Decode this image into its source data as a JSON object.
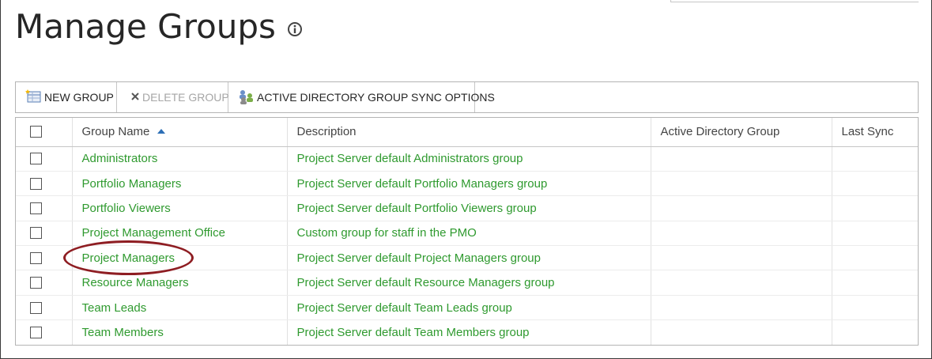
{
  "page": {
    "title": "Manage Groups"
  },
  "toolbar": {
    "new_group": "NEW GROUP",
    "delete_group": "DELETE GROUP",
    "ad_sync": "ACTIVE DIRECTORY GROUP SYNC OPTIONS"
  },
  "table": {
    "columns": [
      "Group Name",
      "Description",
      "Active Directory Group",
      "Last Sync"
    ],
    "sorted_column": "Group Name",
    "sort_direction": "ascending",
    "rows": [
      {
        "name": "Administrators",
        "description": "Project Server default Administrators group",
        "ad_group": "",
        "last_sync": ""
      },
      {
        "name": "Portfolio Managers",
        "description": "Project Server default Portfolio Managers group",
        "ad_group": "",
        "last_sync": ""
      },
      {
        "name": "Portfolio Viewers",
        "description": "Project Server default Portfolio Viewers group",
        "ad_group": "",
        "last_sync": ""
      },
      {
        "name": "Project Management Office",
        "description": "Custom group for staff in the PMO",
        "ad_group": "",
        "last_sync": ""
      },
      {
        "name": "Project Managers",
        "description": "Project Server default Project Managers group",
        "ad_group": "",
        "last_sync": ""
      },
      {
        "name": "Resource Managers",
        "description": "Project Server default Resource Managers group",
        "ad_group": "",
        "last_sync": ""
      },
      {
        "name": "Team Leads",
        "description": "Project Server default Team Leads group",
        "ad_group": "",
        "last_sync": ""
      },
      {
        "name": "Team Members",
        "description": "Project Server default Team Members group",
        "ad_group": "",
        "last_sync": ""
      }
    ]
  },
  "colors": {
    "link": "#2f9a2f",
    "sort_arrow": "#2d6fb6",
    "highlight": "#8e1d22",
    "disabled": "#a6a6a6"
  },
  "icons": {
    "new_group": "new-group-icon",
    "delete_group": "delete-x-icon",
    "ad_sync": "directory-sync-icon",
    "info": "info-icon"
  }
}
